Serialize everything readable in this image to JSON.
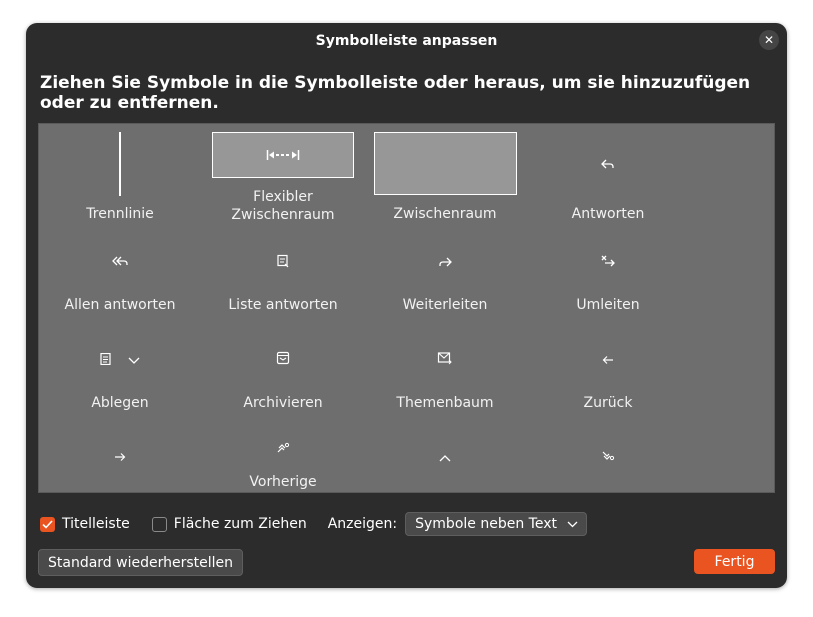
{
  "dialog": {
    "title": "Symbolleiste anpassen",
    "close_icon": "close-icon",
    "heading": "Ziehen Sie Symbole in die Symbolleiste oder heraus, um sie hinzuzufügen oder zu entfernen."
  },
  "palette": {
    "items": [
      {
        "label": "Trennlinie",
        "icon": "separator-line"
      },
      {
        "label": "Flexibler\nZwischenraum",
        "icon": "flexible-space-icon"
      },
      {
        "label": "Zwischenraum",
        "icon": "space-box"
      },
      {
        "label": "Antworten",
        "icon": "reply-icon"
      },
      {
        "label": "Allen antworten",
        "icon": "reply-all-icon"
      },
      {
        "label": "Liste antworten",
        "icon": "reply-list-icon"
      },
      {
        "label": "Weiterleiten",
        "icon": "forward-icon"
      },
      {
        "label": "Umleiten",
        "icon": "redirect-icon"
      },
      {
        "label": "Ablegen",
        "icon": "file-icon"
      },
      {
        "label": "Archivieren",
        "icon": "archive-icon"
      },
      {
        "label": "Themenbaum",
        "icon": "thread-icon"
      },
      {
        "label": "Zurück",
        "icon": "back-arrow-icon"
      },
      {
        "label": "",
        "icon": "forward-arrow-icon"
      },
      {
        "label": "Vorherige",
        "icon": "previous-icon"
      },
      {
        "label": "",
        "icon": "chevron-up-icon"
      },
      {
        "label": "",
        "icon": "next-icon"
      }
    ]
  },
  "options": {
    "titlebar_label": "Titelleiste",
    "titlebar_checked": true,
    "dragspace_label": "Fläche zum Ziehen",
    "dragspace_checked": false,
    "show_label": "Anzeigen:",
    "show_value": "Symbole neben Text"
  },
  "buttons": {
    "restore_label": "Standard wiederherstellen",
    "done_label": "Fertig"
  },
  "colors": {
    "accent": "#e95420",
    "dialog_bg": "#2c2c2c",
    "palette_bg": "#6e6e6e"
  }
}
